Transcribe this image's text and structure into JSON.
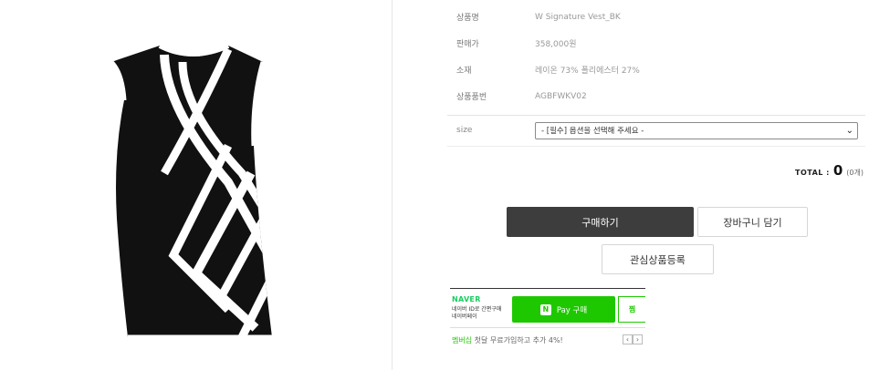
{
  "product": {
    "image_alt": "vest-product-image",
    "rows": [
      {
        "label": "상품명",
        "value": "W Signature Vest_BK"
      },
      {
        "label": "판매가",
        "value": "358,000원"
      },
      {
        "label": "소재",
        "value": "레이온 73% 폴리에스터 27%"
      },
      {
        "label": "상품품번",
        "value": "AGBFWKV02"
      }
    ]
  },
  "option": {
    "label": "size",
    "select_value": "- [필수] 옵션을 선택해 주세요 -"
  },
  "total": {
    "label": "TOTAL :",
    "amount": "0",
    "count": "(0개)"
  },
  "buttons": {
    "buy": "구매하기",
    "cart": "장바구니 담기",
    "wish": "관심상품등록"
  },
  "naver_pay": {
    "logo": "NAVER",
    "desc_line1": "네이버 ID로 간편구매",
    "desc_line2": "네이버페이",
    "pay_n": "N",
    "pay_label": "Pay 구매",
    "zzim_label": "찜"
  },
  "promo": {
    "highlight": "멤버십",
    "text": "첫달 무료가입하고 추가 4%!",
    "prev": "‹",
    "next": "›"
  },
  "colors": {
    "buy_button": "#3d3d3d",
    "naver_green": "#1ec800"
  }
}
